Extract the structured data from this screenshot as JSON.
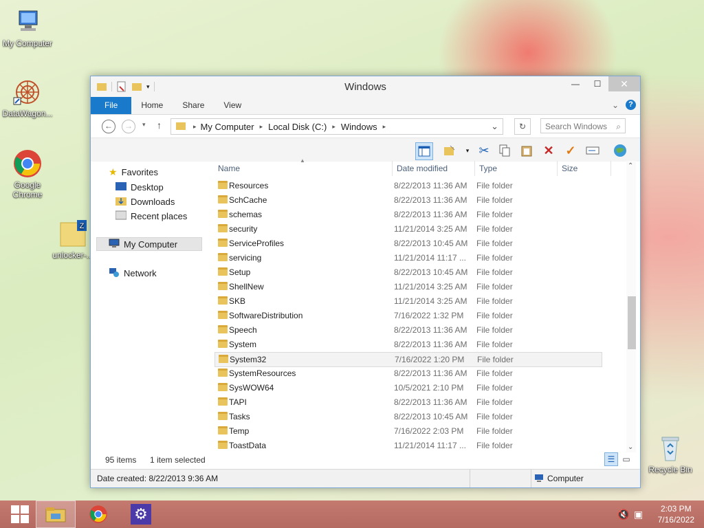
{
  "desktop": {
    "icons": [
      {
        "label": "My Computer"
      },
      {
        "label": "DataWagon..."
      },
      {
        "label": "Google Chrome"
      },
      {
        "label": "unlocker-..."
      },
      {
        "label": "Recycle Bin"
      }
    ]
  },
  "window": {
    "title": "Windows",
    "ribbon_tabs": [
      "File",
      "Home",
      "Share",
      "View"
    ],
    "address": {
      "segments": [
        "My Computer",
        "Local Disk (C:)",
        "Windows"
      ],
      "search_placeholder": "Search Windows"
    },
    "nav": {
      "favorites": "Favorites",
      "desktop": "Desktop",
      "downloads": "Downloads",
      "recent": "Recent places",
      "computer": "My Computer",
      "network": "Network"
    },
    "columns": {
      "name": "Name",
      "date": "Date modified",
      "type": "Type",
      "size": "Size"
    },
    "files": [
      {
        "name": "Resources",
        "date": "8/22/2013 11:36 AM",
        "type": "File folder"
      },
      {
        "name": "SchCache",
        "date": "8/22/2013 11:36 AM",
        "type": "File folder"
      },
      {
        "name": "schemas",
        "date": "8/22/2013 11:36 AM",
        "type": "File folder"
      },
      {
        "name": "security",
        "date": "11/21/2014 3:25 AM",
        "type": "File folder"
      },
      {
        "name": "ServiceProfiles",
        "date": "8/22/2013 10:45 AM",
        "type": "File folder"
      },
      {
        "name": "servicing",
        "date": "11/21/2014 11:17 ...",
        "type": "File folder"
      },
      {
        "name": "Setup",
        "date": "8/22/2013 10:45 AM",
        "type": "File folder"
      },
      {
        "name": "ShellNew",
        "date": "11/21/2014 3:25 AM",
        "type": "File folder"
      },
      {
        "name": "SKB",
        "date": "11/21/2014 3:25 AM",
        "type": "File folder"
      },
      {
        "name": "SoftwareDistribution",
        "date": "7/16/2022 1:32 PM",
        "type": "File folder"
      },
      {
        "name": "Speech",
        "date": "8/22/2013 11:36 AM",
        "type": "File folder"
      },
      {
        "name": "System",
        "date": "8/22/2013 11:36 AM",
        "type": "File folder"
      },
      {
        "name": "System32",
        "date": "7/16/2022 1:20 PM",
        "type": "File folder"
      },
      {
        "name": "SystemResources",
        "date": "8/22/2013 11:36 AM",
        "type": "File folder"
      },
      {
        "name": "SysWOW64",
        "date": "10/5/2021 2:10 PM",
        "type": "File folder"
      },
      {
        "name": "TAPI",
        "date": "8/22/2013 11:36 AM",
        "type": "File folder"
      },
      {
        "name": "Tasks",
        "date": "8/22/2013 10:45 AM",
        "type": "File folder"
      },
      {
        "name": "Temp",
        "date": "7/16/2022 2:03 PM",
        "type": "File folder"
      },
      {
        "name": "ToastData",
        "date": "11/21/2014 11:17 ...",
        "type": "File folder"
      }
    ],
    "selected_file": "System32",
    "status": {
      "items": "95 items",
      "selected": "1 item selected"
    },
    "details": {
      "created": "Date created: 8/22/2013 9:36 AM",
      "location": "Computer"
    }
  },
  "taskbar": {
    "time": "2:03 PM",
    "date": "7/16/2022"
  }
}
